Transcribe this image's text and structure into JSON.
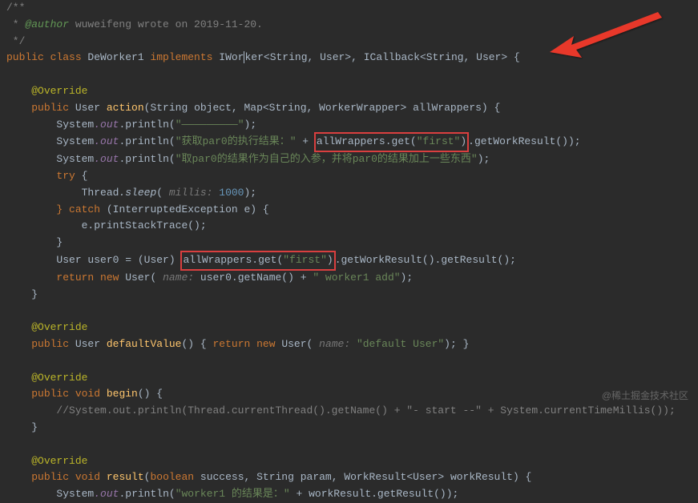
{
  "doc": {
    "l0": "/**",
    "l1_prefix": " * ",
    "author_tag": "@author",
    "author_text": " wuweifeng wrote on 2019-11-20.",
    "l2": " */"
  },
  "decl": {
    "public": "public ",
    "class_kw": "class ",
    "class_name": "DeWorker1 ",
    "implements": "implements ",
    "iworker": "IWorker",
    "gen1": "<String, User>, ",
    "icallback": "ICallback",
    "gen2": "<String, User> {"
  },
  "m1": {
    "override": "@Override",
    "public": "public ",
    "ret": "User ",
    "name": "action",
    "sig": "(String object, Map<String, WorkerWrapper> allWrappers) {",
    "sys": "System",
    "out": ".out.",
    "println": "println",
    "p1_open": "(",
    "p1_str": "\"—————————\"",
    "close_paren": ");",
    "p2_str1": "\"获取par0的执行结果：\"",
    "plus": " + ",
    "hl1": "allWrappers.get(",
    "hl1_str": "\"first\"",
    "hl1_close": ")",
    "getWR": ".getWorkResult());",
    "p3_str": "\"取par0的结果作为自己的入参，并将par0的结果加上一些东西\"",
    "try": "try ",
    "brace_o": "{",
    "thread": "Thread",
    "sleep": ".sleep",
    "sleep_open": "( ",
    "millis_hint": "millis: ",
    "sleep_val": "1000",
    "sleep_close": ");",
    "catch": "} catch ",
    "catch_sig": "(InterruptedException e) {",
    "estack": "e.printStackTrace();",
    "brace_c": "}",
    "user0_line_pre": "User user0 = (User) ",
    "hl2": "allWrappers.get(",
    "hl2_str": "\"first\"",
    "hl2_close": ")",
    "user0_line_post": ".getWorkResult().getResult();",
    "return": "return new ",
    "user_ctor": "User",
    "ctor_open": "( ",
    "name_hint": "name: ",
    "getname": "user0.getName() + ",
    "add_str": "\" worker1 add\"",
    "ctor_close": ");"
  },
  "m2": {
    "override": "@Override",
    "public": "public ",
    "ret": "User ",
    "name": "defaultValue",
    "sig": "() { ",
    "return": "return new ",
    "user": "User",
    "open": "( ",
    "hint": "name: ",
    "str": "\"default User\"",
    "close": "); }"
  },
  "m3": {
    "override": "@Override",
    "public": "public ",
    "ret": "void ",
    "name": "begin",
    "sig": "() {",
    "comment": "//System.out.println(Thread.currentThread().getName() + \"- start --\" + System.currentTimeMillis());",
    "brace_c": "}"
  },
  "m4": {
    "override": "@Override",
    "public": "public ",
    "ret": "void ",
    "name": "result",
    "sig": "(",
    "bool": "boolean ",
    "sig2": "success, String param, WorkResult<User> workResult) {",
    "sys": "System",
    "out": ".out.",
    "println": "println",
    "open": "(",
    "str": "\"worker1 的结果是：\"",
    "plus": " + workResult.getResult());"
  },
  "watermark": "@稀土掘金技术社区"
}
